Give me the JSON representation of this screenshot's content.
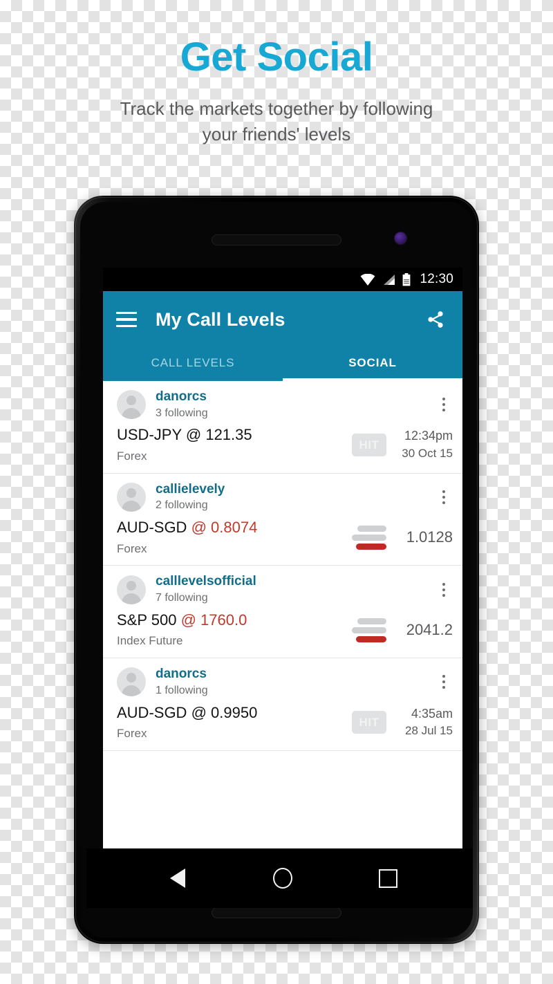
{
  "promo": {
    "headline": "Get Social",
    "subhead": "Track the markets together by following your friends' levels",
    "headline_color": "#17a8d4",
    "subhead_color": "#58595b"
  },
  "device": {
    "statusbar": {
      "time": "12:30",
      "icons": [
        "wifi-icon",
        "cellular-signal-icon",
        "battery-icon"
      ]
    },
    "navbar": {
      "back_label": "Back",
      "home_label": "Home",
      "recents_label": "Recents"
    }
  },
  "app": {
    "accent_color": "#1082a8",
    "appbar": {
      "menu_icon": "hamburger-menu-icon",
      "title": "My Call Levels",
      "share_icon": "share-icon"
    },
    "tabs": [
      {
        "label": "CALL LEVELS",
        "active": false
      },
      {
        "label": "SOCIAL",
        "active": true
      }
    ],
    "list": [
      {
        "username": "danorcs",
        "following": "3 following",
        "instrument": "USD-JPY",
        "at": "@",
        "level": "121.35",
        "level_alert": false,
        "asset_class": "Forex",
        "indicator": "hit-badge",
        "hit_label": "HIT",
        "time": "12:34pm",
        "date": "30 Oct 15"
      },
      {
        "username": "callielevely",
        "following": "2 following",
        "instrument": "AUD-SGD",
        "at": "@",
        "level": "0.8074",
        "level_alert": true,
        "asset_class": "Forex",
        "indicator": "level-bars",
        "price": "1.0128"
      },
      {
        "username": "calllevelsofficial",
        "following": "7 following",
        "instrument": "S&P 500",
        "at": "@",
        "level": "1760.0",
        "level_alert": true,
        "asset_class": "Index Future",
        "indicator": "level-bars",
        "price": "2041.2"
      },
      {
        "username": "danorcs",
        "following": "1 following",
        "instrument": "AUD-SGD",
        "at": "@",
        "level": "0.9950",
        "level_alert": false,
        "asset_class": "Forex",
        "indicator": "hit-badge",
        "hit_label": "HIT",
        "time": "4:35am",
        "date": "28 Jul 15"
      }
    ],
    "colors": {
      "username": "#116d8a",
      "alert_level": "#c0392b",
      "bar_red": "#bf2a22",
      "bar_gray": "#cfd0d1",
      "hit_badge_bg": "#e0e1e2"
    }
  }
}
